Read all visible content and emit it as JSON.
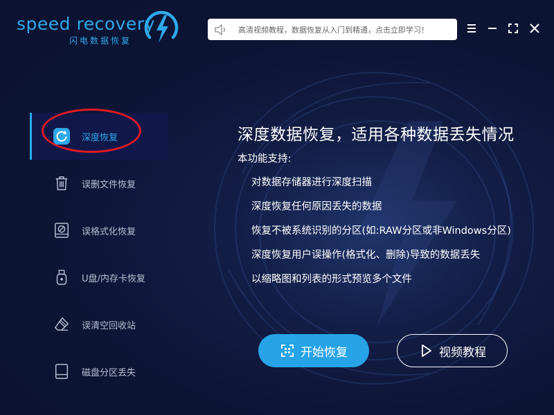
{
  "header": {
    "logo_text": "speed recovery",
    "logo_subtitle": "闪电数据恢复",
    "notice": "高清视频教程，数据恢复从入门到精通，点击立即学习！",
    "speaker_icon": "speaker-icon",
    "menu_icon": "menu-icon",
    "minimize_icon": "minimize-icon",
    "maximize_icon": "maximize-icon",
    "close_icon": "close-icon"
  },
  "sidebar": {
    "items": [
      {
        "label": "深度恢复",
        "icon": "refresh-circle-icon",
        "active": true
      },
      {
        "label": "误删文件恢复",
        "icon": "trash-icon",
        "active": false
      },
      {
        "label": "误格式化恢复",
        "icon": "disk-format-icon",
        "active": false
      },
      {
        "label": "U盘/内存卡恢复",
        "icon": "usb-drive-icon",
        "active": false
      },
      {
        "label": "误清空回收站",
        "icon": "eraser-icon",
        "active": false
      },
      {
        "label": "磁盘分区丢失",
        "icon": "hard-disk-icon",
        "active": false
      }
    ]
  },
  "main": {
    "title": "深度数据恢复，适用各种数据丢失情况",
    "support_label": "本功能支持:",
    "features": [
      "对数据存储器进行深度扫描",
      "深度恢复任何原因丢失的数据",
      "恢复不被系统识别的分区(如:RAW分区或非Windows分区)",
      "深度恢复用户误操作(格式化、删除)导致的数据丢失",
      "以缩略图和列表的形式预览多个文件"
    ],
    "start_button": "开始恢复",
    "video_button": "视频教程"
  },
  "colors": {
    "accent": "#27a3e8",
    "background": "#0d1535",
    "highlight_ellipse": "#e01a24"
  }
}
